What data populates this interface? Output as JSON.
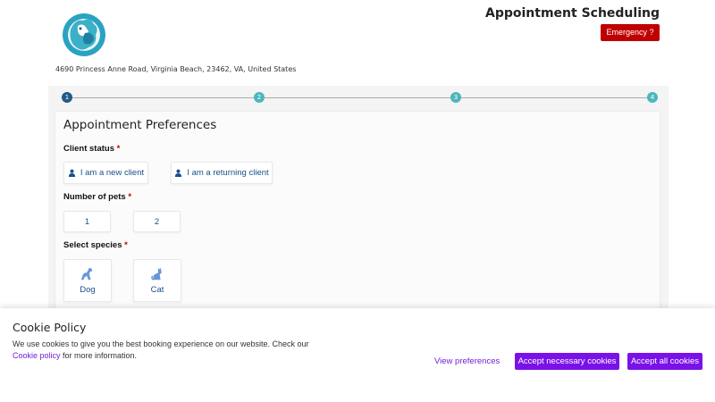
{
  "header": {
    "address": "4690 Princess Anne Road, Virginia Beach, 23462, VA, United States",
    "title": "Appointment Scheduling",
    "emergency_label": "Emergency ?",
    "logo_icon": "pet-clinic-logo-icon"
  },
  "stepper": {
    "steps": [
      "1",
      "2",
      "3",
      "4"
    ],
    "active_step": 1
  },
  "form": {
    "title": "Appointment Preferences",
    "client_status": {
      "label": "Client status",
      "required_mark": "*",
      "options": [
        "I am a new client",
        "I am a returning client"
      ]
    },
    "pets": {
      "label": "Number of pets",
      "required_mark": "*",
      "options": [
        "1",
        "2"
      ]
    },
    "species": {
      "label": "Select species",
      "required_mark": "*",
      "options": [
        "Dog",
        "Cat"
      ]
    }
  },
  "cookie": {
    "title": "Cookie Policy",
    "text_before": "We use cookies to give you the best booking experience on our website. Check our",
    "link_label": "Cookie policy",
    "text_after": " for more information.",
    "view_preferences": "View preferences",
    "accept_necessary": "Accept necessary cookies",
    "accept_all": "Accept all cookies"
  },
  "colors": {
    "emergency": "#c00000",
    "step_active": "#1f5c86",
    "step_inactive": "#4db6bd",
    "option_text": "#1a4f8a",
    "cookie_accent": "#7a12e8"
  }
}
